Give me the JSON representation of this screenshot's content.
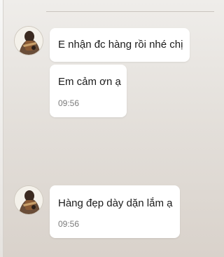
{
  "conversation": {
    "messages": [
      {
        "text": "E nhận đc hàng rồi nhé chị",
        "time": ""
      },
      {
        "text": "Em cảm ơn ạ",
        "time": "09:56"
      },
      {
        "text": "Hàng đẹp dày dặn lắm ạ",
        "time": "09:56"
      }
    ]
  },
  "colors": {
    "bubble_bg": "#ffffff",
    "chat_bg": "#e4e0db",
    "timestamp": "#7b7b7b"
  },
  "icons": [
    "avatar"
  ]
}
